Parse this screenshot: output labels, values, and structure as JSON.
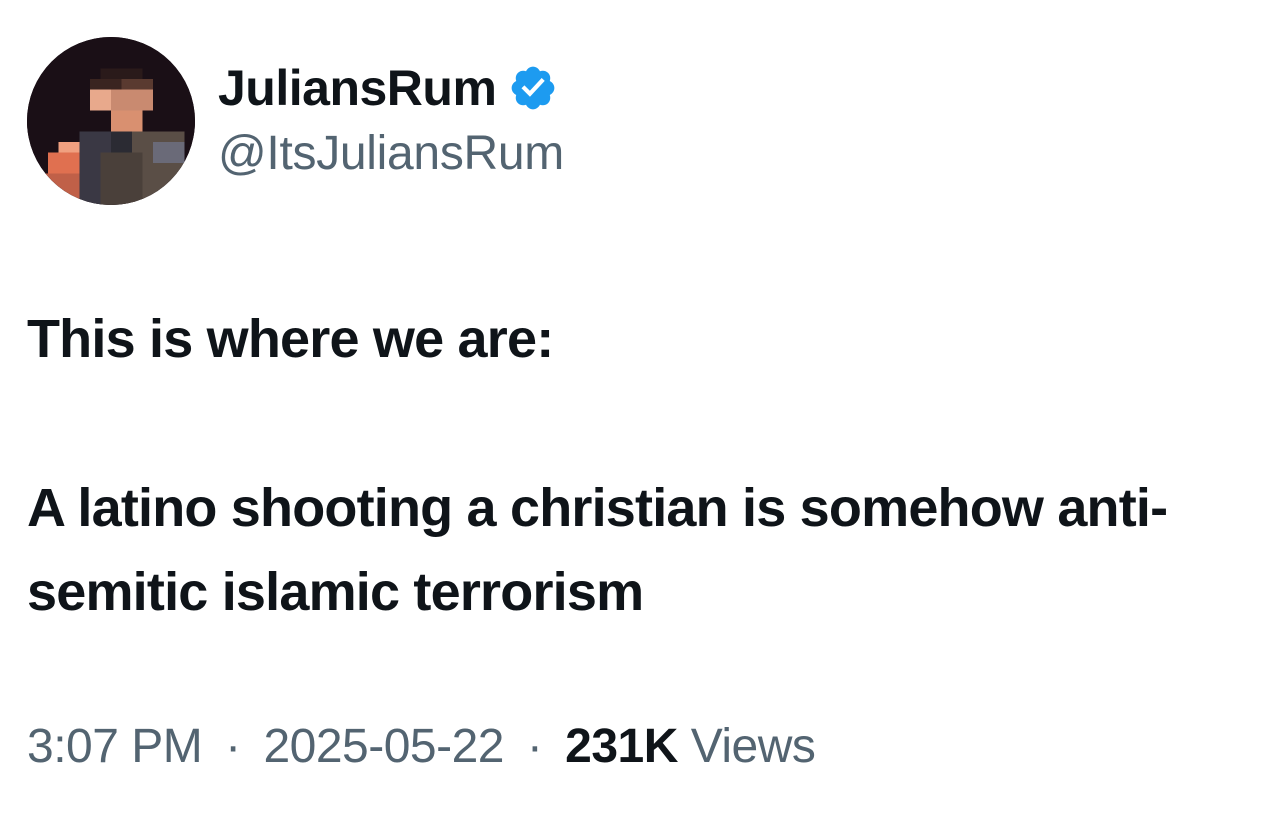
{
  "author": {
    "display_name": "JuliansRum",
    "handle": "@ItsJuliansRum",
    "verified": true,
    "verified_badge_color": "#1d9bf0"
  },
  "tweet": {
    "line1": "This is where we are:",
    "line2": "A latino shooting a christian is somehow anti-semitic islamic terrorism"
  },
  "meta": {
    "time": "3:07 PM",
    "separator": "·",
    "date": "2025-05-22",
    "views_count": "231K",
    "views_label": "Views"
  },
  "colors": {
    "text_primary": "#0f1419",
    "text_secondary": "#536471",
    "background": "#ffffff"
  }
}
